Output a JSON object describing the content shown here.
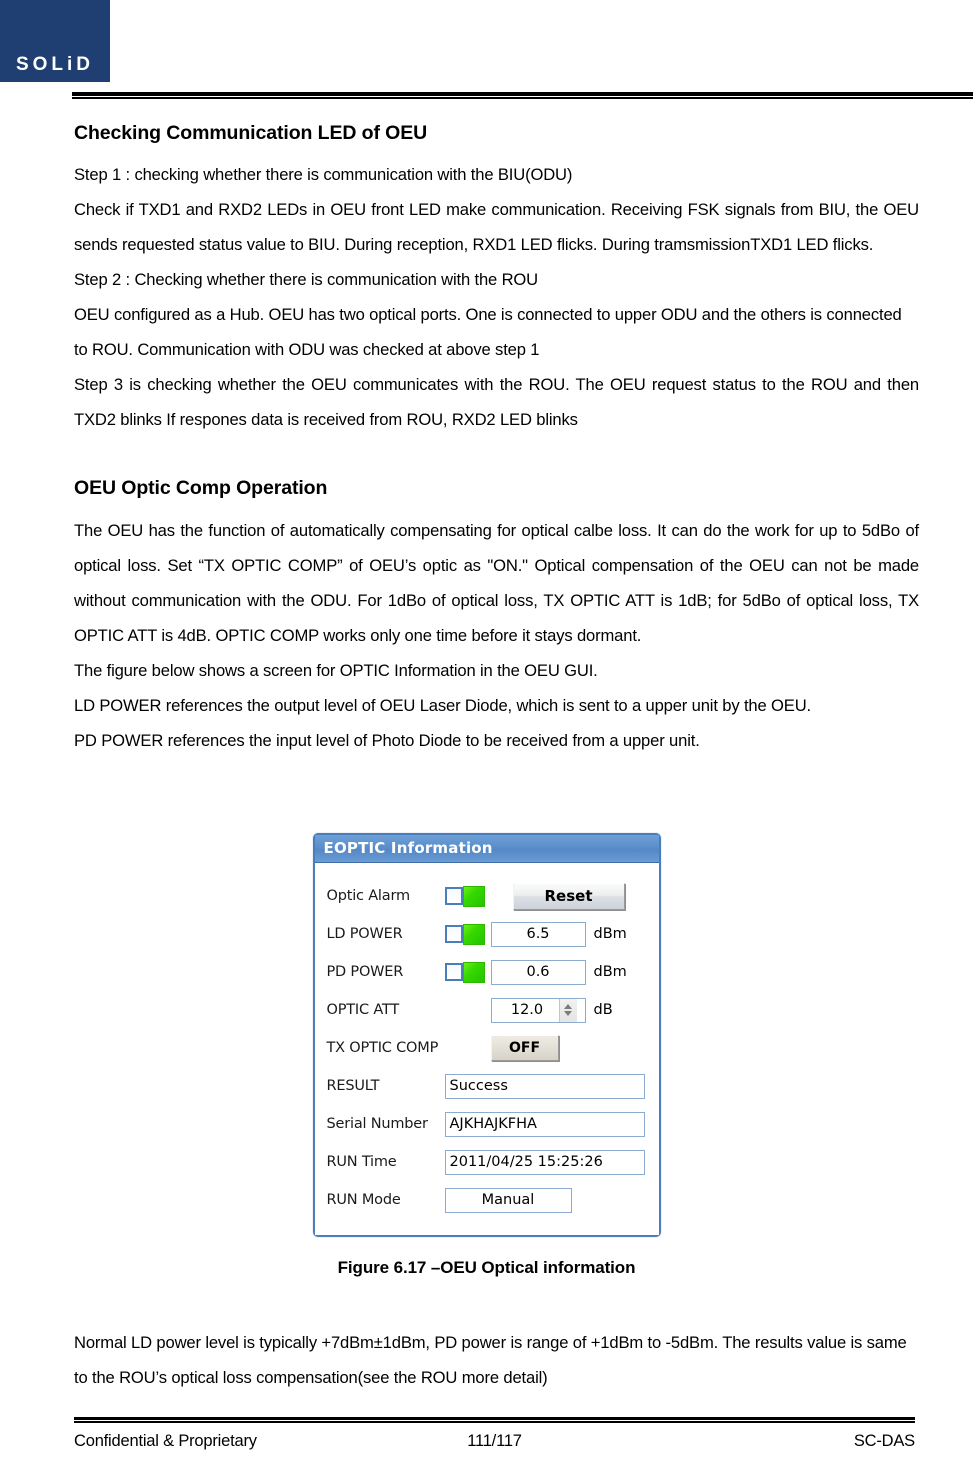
{
  "header": {
    "logo_text": "SOLiD"
  },
  "sections": [
    {
      "title": "Checking Communication LED of OEU",
      "paragraphs": [
        "Step 1 : checking whether there is communication with the BIU(ODU)",
        "Check if TXD1 and RXD2 LEDs in OEU front LED make communication. Receiving FSK signals from BIU, the OEU sends requested status value to BIU. During reception, RXD1 LED flicks. During tramsmissionTXD1 LED flicks.",
        "Step 2 : Checking whether there is communication with the ROU",
        "OEU configured as a Hub. OEU has two optical ports. One is connected to upper ODU and the others is connected to ROU. Communication with ODU was checked at above step 1",
        "Step 3 is checking whether the OEU communicates with the ROU. The OEU request status to the ROU and then TXD2 blinks If respones data is received from ROU, RXD2 LED blinks"
      ]
    },
    {
      "title": "OEU Optic Comp Operation",
      "paragraphs": [
        "The OEU has the function of automatically compensating for optical calbe loss. It can do the work for up to 5dBo of optical loss. Set “TX OPTIC COMP” of OEU’s optic as \"ON.\" Optical compensation of the OEU can not be made without communication with the ODU. For 1dBo of optical loss, TX OPTIC ATT is 1dB; for 5dBo of optical loss, TX OPTIC ATT is 4dB. OPTIC COMP works only one time before it stays dormant.",
        "The figure below shows a screen for OPTIC Information in the OEU GUI.",
        "LD POWER references the output level of OEU Laser Diode, which is sent to a upper unit by the OEU.",
        "PD POWER references the input level of Photo Diode to be received from a upper unit."
      ]
    }
  ],
  "dialog": {
    "title": "EOPTIC Information",
    "reset_button": "Reset",
    "rows": {
      "optic_alarm_label": "Optic Alarm",
      "ld_power_label": "LD POWER",
      "ld_power_value": "6.5",
      "ld_power_unit": "dBm",
      "pd_power_label": "PD POWER",
      "pd_power_value": "0.6",
      "pd_power_unit": "dBm",
      "optic_att_label": "OPTIC ATT",
      "optic_att_value": "12.0",
      "optic_att_unit": "dB",
      "tx_optic_comp_label": "TX OPTIC COMP",
      "tx_optic_comp_value": "OFF",
      "result_label": "RESULT",
      "result_value": "Success",
      "serial_number_label": "Serial Number",
      "serial_number_value": "AJKHAJKFHA",
      "run_time_label": "RUN Time",
      "run_time_value": "2011/04/25 15:25:26",
      "run_mode_label": "RUN Mode",
      "run_mode_value": "Manual"
    },
    "colors": {
      "titlebar": "#5b8fcb",
      "border": "#4a7ebb",
      "led_on": "#35d800"
    }
  },
  "figure_caption": "Figure 6.17 –OEU Optical information",
  "closing_paragraph": "Normal LD power level is typically +7dBm±1dBm, PD power is range of +1dBm to    -5dBm. The results value is same to the ROU’s optical loss compensation(see the ROU more detail)",
  "footer": {
    "left": "Confidential & Proprietary",
    "center": "111/117",
    "right": "SC-DAS"
  }
}
